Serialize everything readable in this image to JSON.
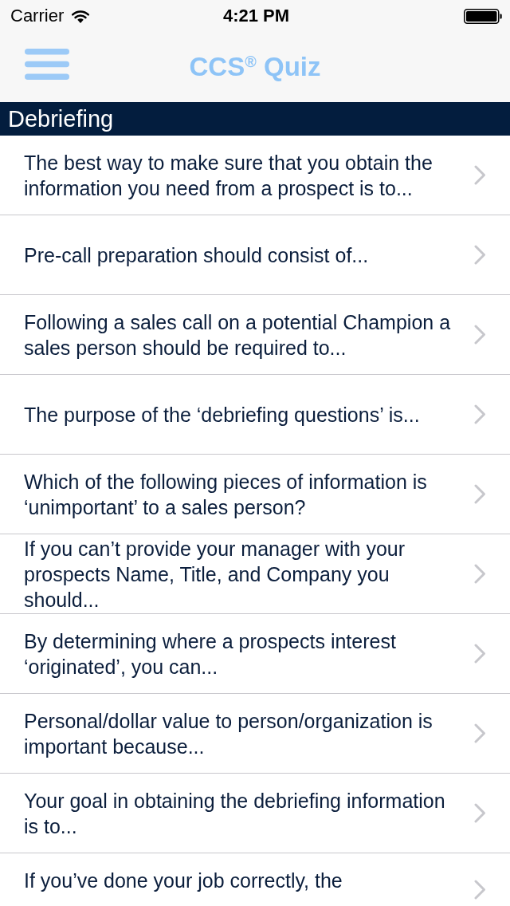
{
  "status_bar": {
    "carrier": "Carrier",
    "time": "4:21 PM"
  },
  "nav_bar": {
    "title": "CCS$^{®}$ Quiz"
  },
  "section": {
    "title": "Debriefing"
  },
  "questions": [
    {
      "text": "The best way to make sure that you obtain the information you need from a prospect is to..."
    },
    {
      "text": "Pre-call preparation should consist of..."
    },
    {
      "text": "Following a sales call on a potential Champion a sales person should be required to..."
    },
    {
      "text": "The purpose of the ‘debriefing questions’ is..."
    },
    {
      "text": "Which of the following pieces of information is ‘unimportant’ to a sales person?"
    },
    {
      "text": "If you can’t provide your manager with your prospects Name, Title, and Company you should..."
    },
    {
      "text": "By determining where a prospects interest ‘originated’, you can..."
    },
    {
      "text": "Personal/dollar value to person/organization is important because..."
    },
    {
      "text": "Your goal in obtaining the debriefing information is to..."
    },
    {
      "text": "If you’ve done your job correctly, the"
    }
  ]
}
